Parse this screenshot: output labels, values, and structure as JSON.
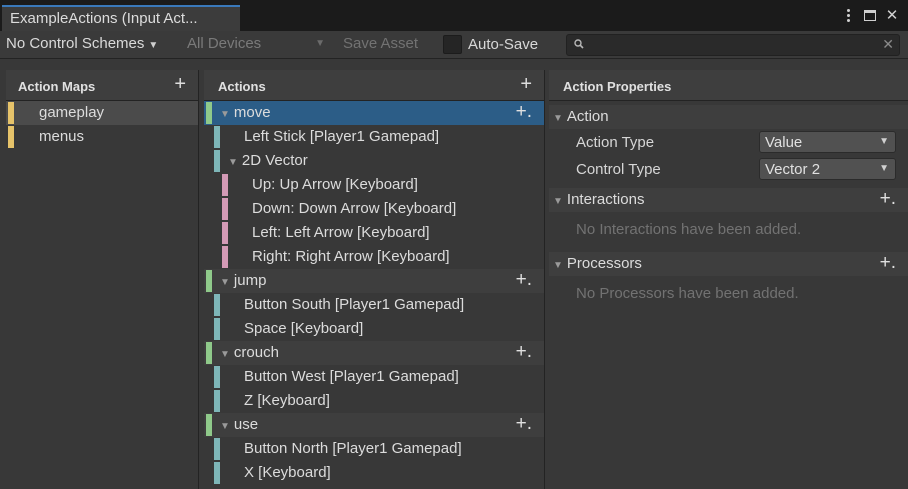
{
  "window": {
    "tab_title": "ExampleActions (Input Act..."
  },
  "toolbar": {
    "control_scheme": "No Control Schemes",
    "devices": "All Devices",
    "save_label": "Save Asset",
    "autosave_label": "Auto-Save",
    "autosave_checked": false,
    "search_value": ""
  },
  "maps": {
    "header": "Action Maps",
    "items": [
      {
        "label": "gameplay",
        "selected": true
      },
      {
        "label": "menus",
        "selected": false
      }
    ]
  },
  "actions": {
    "header": "Actions",
    "rows": [
      {
        "type": "action",
        "label": "move",
        "selected": true
      },
      {
        "type": "binding",
        "label": "Left Stick [Player1 Gamepad]"
      },
      {
        "type": "composite",
        "label": "2D Vector"
      },
      {
        "type": "part",
        "label": "Up: Up Arrow [Keyboard]"
      },
      {
        "type": "part",
        "label": "Down: Down Arrow [Keyboard]"
      },
      {
        "type": "part",
        "label": "Left: Left Arrow [Keyboard]"
      },
      {
        "type": "part",
        "label": "Right: Right Arrow [Keyboard]"
      },
      {
        "type": "action",
        "label": "jump"
      },
      {
        "type": "binding",
        "label": "Button South [Player1 Gamepad]"
      },
      {
        "type": "binding",
        "label": "Space [Keyboard]"
      },
      {
        "type": "action",
        "label": "crouch"
      },
      {
        "type": "binding",
        "label": "Button West [Player1 Gamepad]"
      },
      {
        "type": "binding",
        "label": "Z [Keyboard]"
      },
      {
        "type": "action",
        "label": "use"
      },
      {
        "type": "binding",
        "label": "Button North [Player1 Gamepad]"
      },
      {
        "type": "binding",
        "label": "X [Keyboard]"
      }
    ]
  },
  "properties": {
    "header": "Action Properties",
    "action_section": "Action",
    "action_type_label": "Action Type",
    "action_type_value": "Value",
    "control_type_label": "Control Type",
    "control_type_value": "Vector 2",
    "interactions_section": "Interactions",
    "interactions_empty": "No Interactions have been added.",
    "processors_section": "Processors",
    "processors_empty": "No Processors have been added."
  },
  "colors": {
    "map_stripe": "#e6c36a",
    "action_stripe": "#8fc98a",
    "binding_stripe": "#7eb6b8",
    "part_stripe": "#d49ab6",
    "selection": "#2c5d87",
    "tab_accent": "#3a79bb"
  }
}
